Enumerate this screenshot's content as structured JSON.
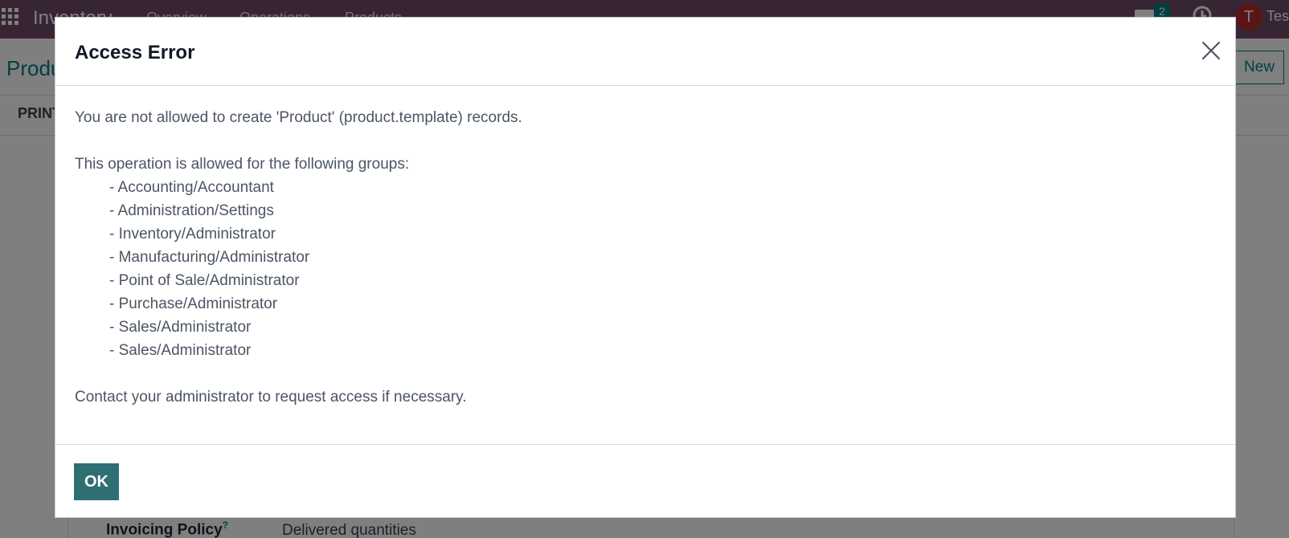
{
  "topbar": {
    "app_name": "Inventory",
    "nav": [
      "Overview",
      "Operations",
      "Products"
    ],
    "chat_count": "2",
    "avatar_initial": "T",
    "user_name": "Test",
    "bar_color": "#714b67"
  },
  "control_panel": {
    "breadcrumb": "Produ",
    "new_label": "New",
    "print_label": "PRINT"
  },
  "form": {
    "invoicing_policy_label": "Invoicing Policy",
    "invoicing_policy_help": "?",
    "invoicing_policy_value": "Delivered quantities"
  },
  "dialog": {
    "title": "Access Error",
    "message_line1": "You are not allowed to create 'Product' (product.template) records.",
    "groups_intro": "This operation is allowed for the following groups:",
    "groups": [
      "- Accounting/Accountant",
      "- Administration/Settings",
      "- Inventory/Administrator",
      "- Manufacturing/Administrator",
      "- Point of Sale/Administrator",
      "- Purchase/Administrator",
      "- Sales/Administrator",
      "- Sales/Administrator"
    ],
    "contact_text": "Contact your administrator to request access if necessary.",
    "ok_label": "OK",
    "accent_color": "#2e6f73"
  }
}
